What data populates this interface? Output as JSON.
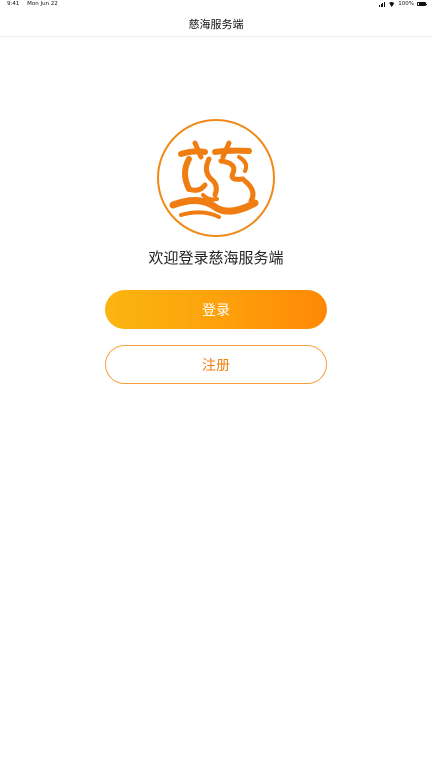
{
  "status_bar": {
    "time": "9:41",
    "date": "Mon Jun 22",
    "battery_percent": "100%",
    "battery_level": 1.0
  },
  "nav": {
    "title": "慈海服务端"
  },
  "logo": {
    "icon": "ci-character-logo-icon",
    "colors": {
      "primary": "#f07d12",
      "border": "#f08a14"
    }
  },
  "welcome": {
    "text": "欢迎登录慈海服务端"
  },
  "buttons": {
    "login_label": "登录",
    "register_label": "注册"
  },
  "colors": {
    "gradient_start": "#fbb512",
    "gradient_end": "#ff8806",
    "accent": "#f07f12"
  }
}
